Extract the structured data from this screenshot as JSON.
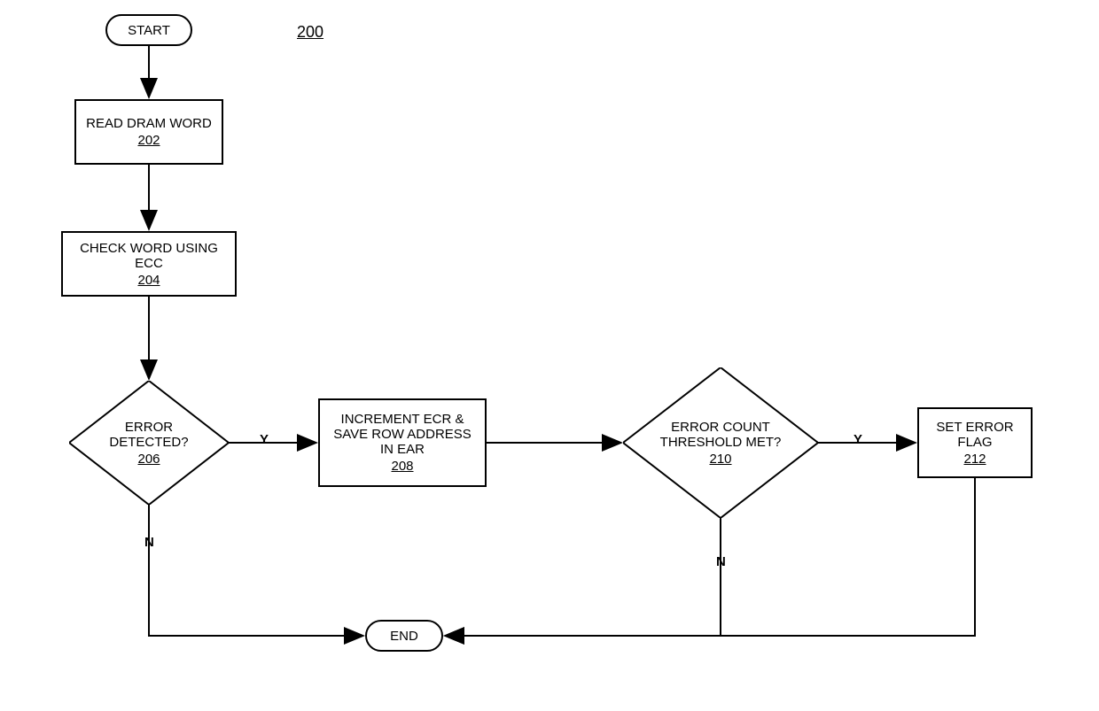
{
  "figure_number": "200",
  "terminators": {
    "start": "START",
    "end": "END"
  },
  "processes": {
    "read_dram": {
      "text": "READ DRAM WORD",
      "num": "202"
    },
    "check_ecc": {
      "text": "CHECK WORD USING ECC",
      "num": "204"
    },
    "increment": {
      "text": "INCREMENT ECR & SAVE ROW ADDRESS IN EAR",
      "num": "208"
    },
    "set_flag": {
      "text": "SET ERROR FLAG",
      "num": "212"
    }
  },
  "decisions": {
    "error_detected": {
      "text": "ERROR DETECTED?",
      "num": "206"
    },
    "threshold": {
      "text": "ERROR COUNT THRESHOLD MET?",
      "num": "210"
    }
  },
  "edge_labels": {
    "y1": "Y",
    "n1": "N",
    "y2": "Y",
    "n2": "N"
  }
}
